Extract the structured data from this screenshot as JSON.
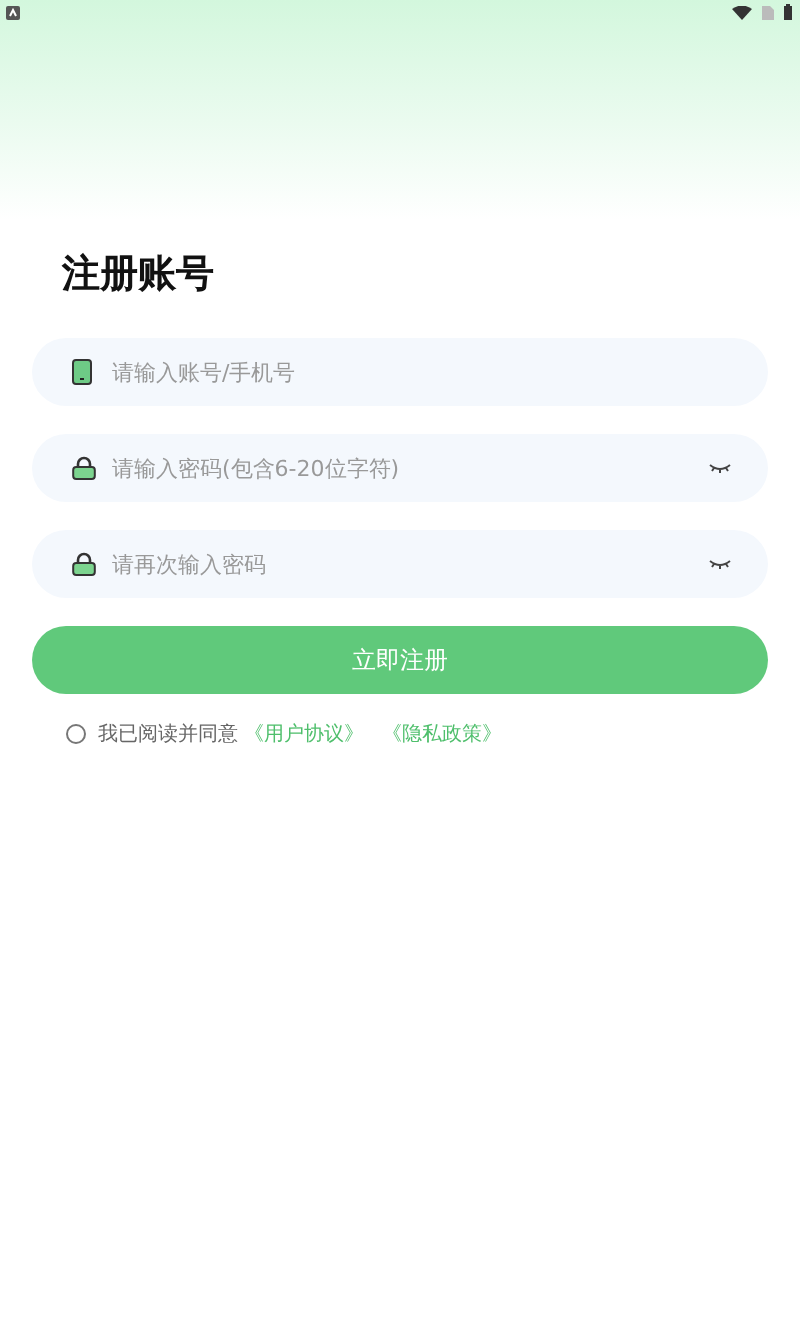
{
  "title": "注册账号",
  "fields": [
    {
      "kind": "account",
      "placeholder": "请输入账号/手机号"
    },
    {
      "kind": "password",
      "placeholder": "请输入密码(包含6-20位字符)"
    },
    {
      "kind": "password",
      "placeholder": "请再次输入密码"
    }
  ],
  "submit": "立即注册",
  "agreement": {
    "checked": false,
    "text": "我已阅读并同意",
    "links": [
      "《用户协议》",
      "《隐私政策》"
    ]
  }
}
